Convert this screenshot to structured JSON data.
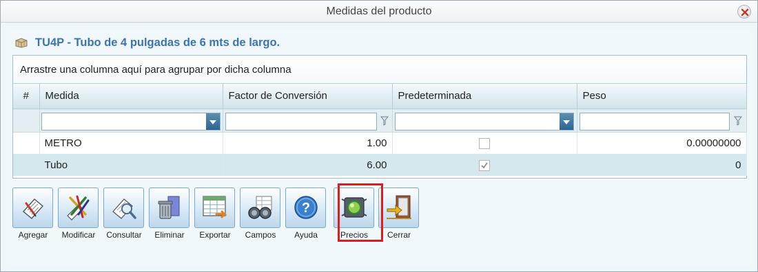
{
  "window": {
    "title": "Medidas del producto"
  },
  "product": {
    "title": "TU4P - Tubo de 4 pulgadas de 6 mts de largo."
  },
  "grid": {
    "group_panel": "Arrastre una columna aquí para agrupar por dicha columna",
    "columns": [
      "#",
      "Medida",
      "Factor de Conversión",
      "Predeterminada",
      "Peso"
    ],
    "rows": [
      {
        "medida": "METRO",
        "factor": "1.00",
        "predeterminada": false,
        "peso": "0.00000000"
      },
      {
        "medida": "Tubo",
        "factor": "6.00",
        "predeterminada": true,
        "peso": "0"
      }
    ]
  },
  "toolbar": {
    "buttons": [
      {
        "label": "Agregar",
        "icon": "add-document-icon"
      },
      {
        "label": "Modificar",
        "icon": "edit-tools-icon"
      },
      {
        "label": "Consultar",
        "icon": "magnifier-document-icon"
      },
      {
        "label": "Eliminar",
        "icon": "trash-icon"
      },
      {
        "label": "Exportar",
        "icon": "export-spreadsheet-icon"
      },
      {
        "label": "Campos",
        "icon": "binoculars-icon"
      },
      {
        "label": "Ayuda",
        "icon": "help-icon"
      },
      {
        "label": "Precios",
        "icon": "traffic-light-icon"
      },
      {
        "label": "Cerrar",
        "icon": "exit-door-icon"
      }
    ],
    "highlighted": "Precios"
  },
  "colors": {
    "title_blue": "#3b73b5",
    "highlight_red": "#e01b1b",
    "alt_row": "#d4e8ee"
  }
}
